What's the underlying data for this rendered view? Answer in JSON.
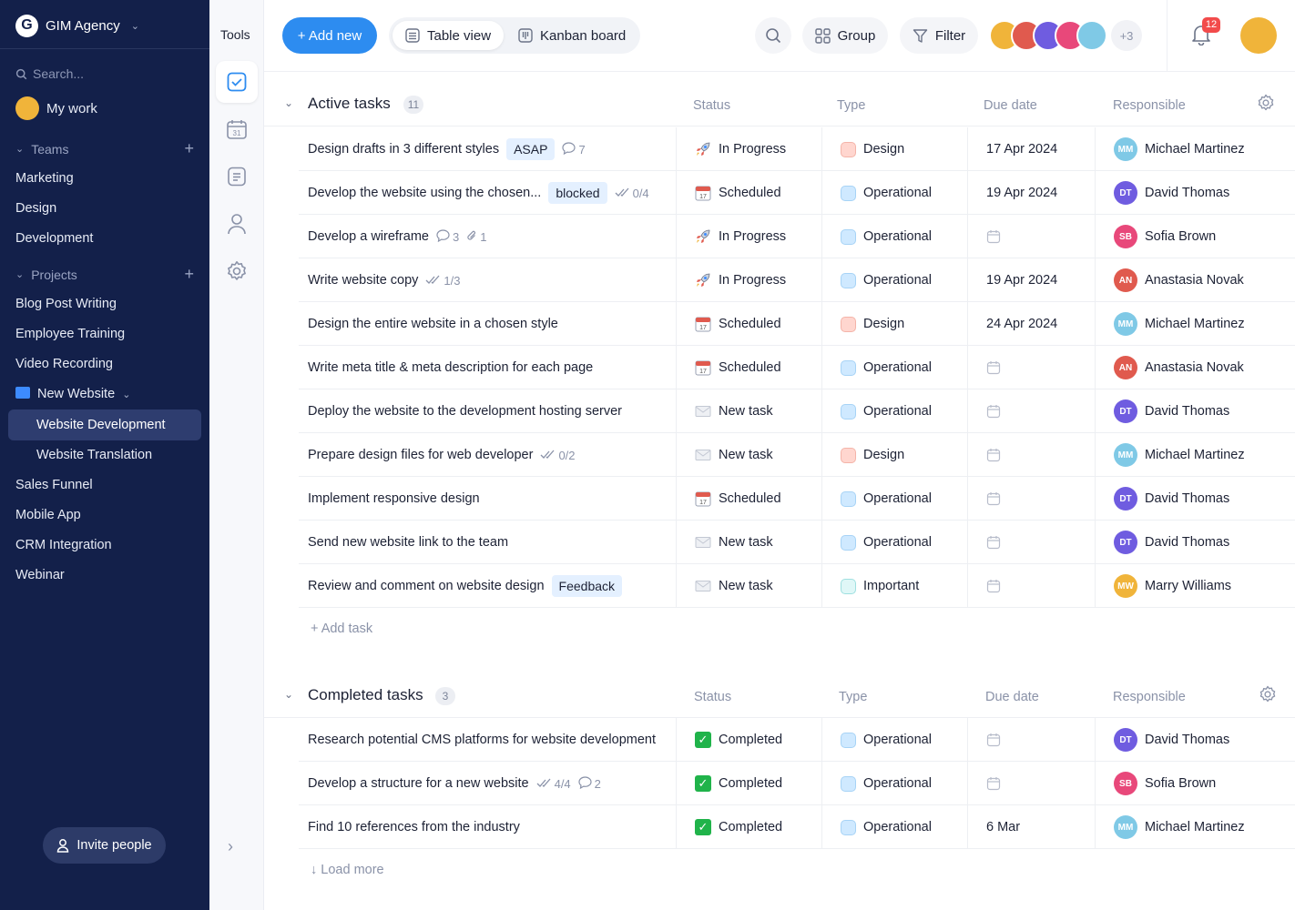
{
  "colors": {
    "sidebar_bg": "#13204a",
    "accent": "#2d8cf0",
    "badge": "#f24b4b",
    "completed": "#20b34a"
  },
  "workspace": {
    "name": "GIM Agency",
    "logo_letter": "G"
  },
  "sidebar": {
    "search_placeholder": "Search...",
    "my_work": "My work",
    "teams_label": "Teams",
    "teams": [
      "Marketing",
      "Design",
      "Development"
    ],
    "projects_label": "Projects",
    "projects_top": [
      "Blog Post Writing",
      "Employee Training",
      "Video Recording"
    ],
    "new_website": "New Website",
    "new_website_children": [
      "Website Development",
      "Website Translation"
    ],
    "projects_bottom": [
      "Sales Funnel",
      "Mobile App",
      "CRM Integration",
      "Webinar"
    ],
    "invite": "Invite people"
  },
  "tools": {
    "title": "Tools",
    "icons": [
      "task-check-icon",
      "calendar-icon",
      "document-icon",
      "person-icon",
      "settings-icon"
    ],
    "calendar_day": "31"
  },
  "toolbar": {
    "add_new": "+ Add new",
    "table_view": "Table view",
    "kanban_board": "Kanban board",
    "group": "Group",
    "filter": "Filter",
    "avatar_overflow": "+3",
    "notifications": "12"
  },
  "columns": {
    "status": "Status",
    "type": "Type",
    "due": "Due date",
    "responsible": "Responsible"
  },
  "active": {
    "title": "Active tasks",
    "count": "11",
    "add_task": "+ Add task",
    "rows": [
      {
        "name": "Design drafts in 3 different styles",
        "tag": "ASAP",
        "comments": "7",
        "status": "In Progress",
        "status_icon": "rocket",
        "type": "Design",
        "due": "17 Apr 2024",
        "resp": "Michael Martinez"
      },
      {
        "name": "Develop the website using the chosen...",
        "tag": "blocked",
        "checks": "0/4",
        "status": "Scheduled",
        "status_icon": "calendar",
        "type": "Operational",
        "due": "19 Apr 2024",
        "resp": "David Thomas"
      },
      {
        "name": "Develop a wireframe",
        "comments": "3",
        "attachments": "1",
        "status": "In Progress",
        "status_icon": "rocket",
        "type": "Operational",
        "due": "",
        "resp": "Sofia Brown"
      },
      {
        "name": "Write website copy",
        "checks": "1/3",
        "status": "In Progress",
        "status_icon": "rocket",
        "type": "Operational",
        "due": "19 Apr 2024",
        "resp": "Anastasia Novak"
      },
      {
        "name": "Design the entire website in a chosen style",
        "status": "Scheduled",
        "status_icon": "calendar",
        "type": "Design",
        "due": "24 Apr 2024",
        "resp": "Michael Martinez"
      },
      {
        "name": "Write meta title & meta description for each page",
        "status": "Scheduled",
        "status_icon": "calendar",
        "type": "Operational",
        "due": "",
        "resp": "Anastasia Novak"
      },
      {
        "name": "Deploy the website to the development hosting server",
        "status": "New task",
        "status_icon": "envelope",
        "type": "Operational",
        "due": "",
        "resp": "David Thomas"
      },
      {
        "name": "Prepare design files for web developer",
        "checks": "0/2",
        "status": "New task",
        "status_icon": "envelope",
        "type": "Design",
        "due": "",
        "resp": "Michael Martinez"
      },
      {
        "name": "Implement responsive design",
        "status": "Scheduled",
        "status_icon": "calendar",
        "type": "Operational",
        "due": "",
        "resp": "David Thomas"
      },
      {
        "name": "Send new website link to the team",
        "status": "New task",
        "status_icon": "envelope",
        "type": "Operational",
        "due": "",
        "resp": "David Thomas"
      },
      {
        "name": "Review and comment on website design",
        "tag": "Feedback",
        "status": "New task",
        "status_icon": "envelope",
        "type": "Important",
        "due": "",
        "resp": "Marry Williams"
      }
    ]
  },
  "completed": {
    "title": "Completed tasks",
    "count": "3",
    "load_more": "↓ Load more",
    "rows": [
      {
        "name": "Research potential CMS platforms for website development",
        "status": "Completed",
        "status_icon": "check",
        "type": "Operational",
        "due": "",
        "resp": "David Thomas"
      },
      {
        "name": "Develop a structure for a new website",
        "checks": "4/4",
        "comments": "2",
        "status": "Completed",
        "status_icon": "check",
        "type": "Operational",
        "due": "",
        "resp": "Sofia Brown"
      },
      {
        "name": "Find 10 references from the industry",
        "status": "Completed",
        "status_icon": "check",
        "type": "Operational",
        "due": "6 Mar",
        "resp": "Michael Martinez"
      }
    ]
  },
  "people_colors": {
    "Michael Martinez": "#7fc9e6",
    "David Thomas": "#6f5ce0",
    "Sofia Brown": "#e8487a",
    "Anastasia Novak": "#e05a4e",
    "Marry Williams": "#f0b43a"
  },
  "people_initials": {
    "Michael Martinez": "MM",
    "David Thomas": "DT",
    "Sofia Brown": "SB",
    "Anastasia Novak": "AN",
    "Marry Williams": "MW"
  }
}
